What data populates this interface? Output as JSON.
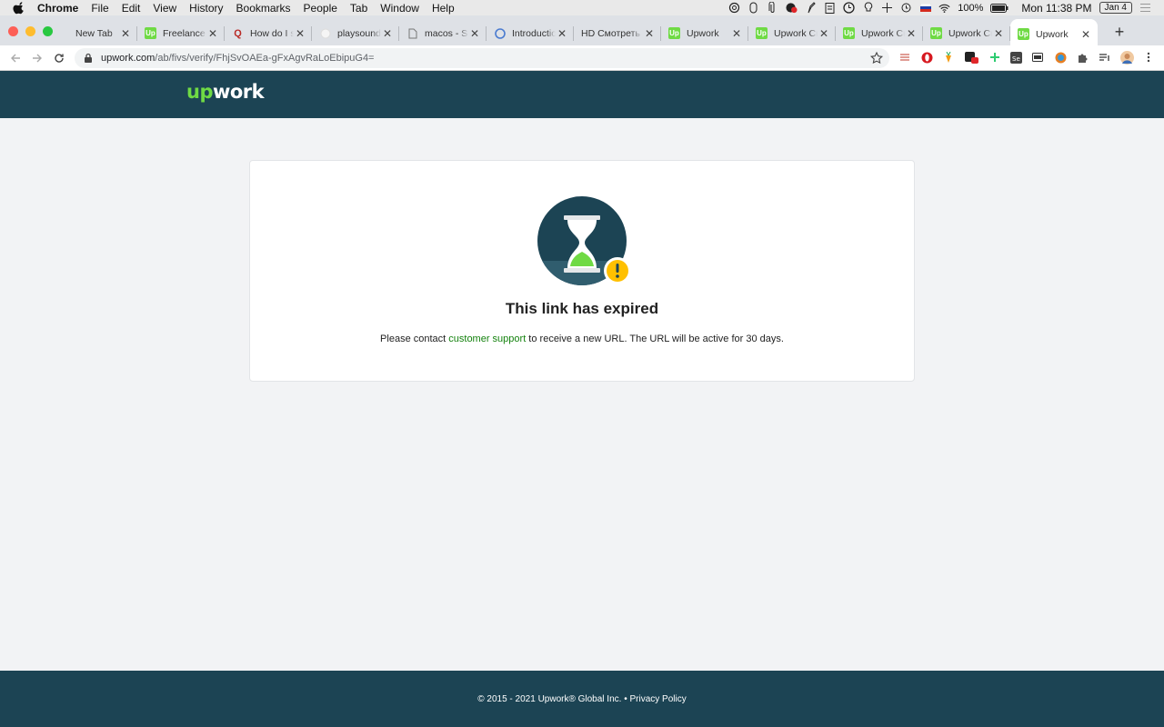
{
  "menubar": {
    "items": [
      "Chrome",
      "File",
      "Edit",
      "View",
      "History",
      "Bookmarks",
      "People",
      "Tab",
      "Window",
      "Help"
    ],
    "battery": "100%",
    "clock": "Mon 11:38 PM",
    "date": "Jan 4"
  },
  "tabs": [
    {
      "title": "New Tab",
      "favicon": "none"
    },
    {
      "title": "Freelance |",
      "favicon": "upwork-icon"
    },
    {
      "title": "How do I su",
      "favicon": "quora-icon"
    },
    {
      "title": "playsound",
      "favicon": "blank-icon"
    },
    {
      "title": "macos - Sc",
      "favicon": "document-icon"
    },
    {
      "title": "Introductio",
      "favicon": "c-icon"
    },
    {
      "title": "HD Смотреть",
      "favicon": "hd-icon"
    },
    {
      "title": "Upwork",
      "favicon": "upwork-icon"
    },
    {
      "title": "Upwork Cu",
      "favicon": "upwork-icon"
    },
    {
      "title": "Upwork Cu",
      "favicon": "upwork-icon"
    },
    {
      "title": "Upwork Cu",
      "favicon": "upwork-icon"
    },
    {
      "title": "Upwork",
      "favicon": "upwork-icon",
      "active": true
    }
  ],
  "address": {
    "host": "upwork.com",
    "path": "/ab/fivs/verify/FhjSvOAEa-gFxAgvRaLoEbipuG4="
  },
  "header": {
    "logo_up": "up",
    "logo_rest": "work"
  },
  "main": {
    "title": "This link has expired",
    "message_before": "Please contact ",
    "link_text": "customer support",
    "message_after": " to receive a new URL. The URL will be active for 30 days."
  },
  "footer": {
    "copyright": "© 2015 - 2021 Upwork® Global Inc. • ",
    "privacy": "Privacy Policy"
  },
  "colors": {
    "brand_dark": "#1c4454",
    "brand_green": "#6fda44",
    "link_green": "#14820e",
    "warning_yellow": "#ffc000",
    "page_bg": "#f2f3f5"
  }
}
